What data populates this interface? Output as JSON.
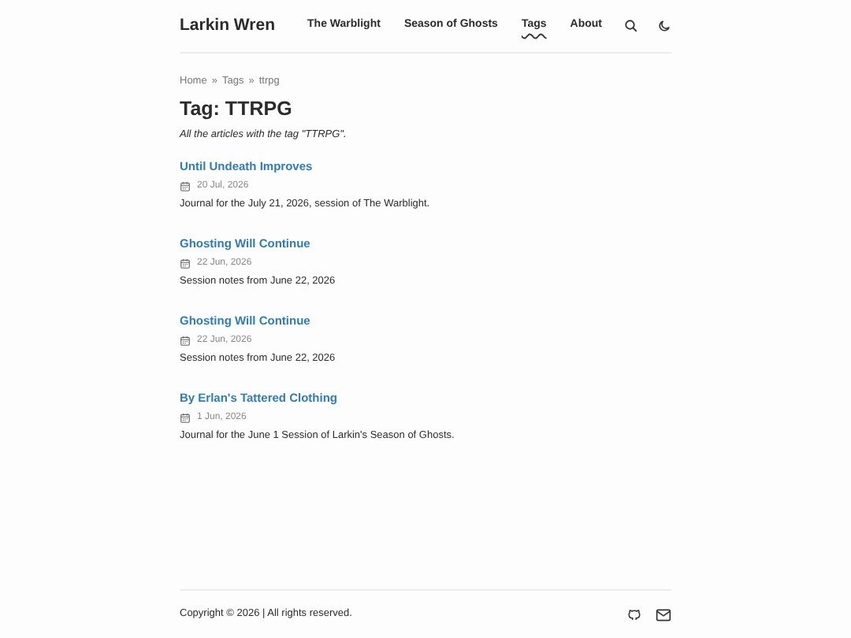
{
  "site_title": "Larkin Wren",
  "nav": [
    {
      "label": "The Warblight",
      "selected": false
    },
    {
      "label": "Season of Ghosts",
      "selected": false
    },
    {
      "label": "Tags",
      "selected": true
    },
    {
      "label": "About",
      "selected": false
    }
  ],
  "breadcrumbs": {
    "separator": "»",
    "items": [
      "Home",
      "Tags",
      "ttrpg"
    ]
  },
  "heading": "Tag: TTRPG",
  "subtitle": "All the articles with the tag \"TTRPG\".",
  "articles": [
    {
      "title": "Until Undeath Improves",
      "date": "20 Jul, 2026",
      "summary": "Journal for the July 21, 2026, session of The Warblight."
    },
    {
      "title": "Ghosting Will Continue",
      "date": "22 Jun, 2026",
      "summary": "Session notes from June 22, 2026"
    },
    {
      "title": "Ghosting Will Continue",
      "date": "22 Jun, 2026",
      "summary": "Session notes from June 22, 2026"
    },
    {
      "title": "By Erlan's Tattered Clothing",
      "date": "1 Jun, 2026",
      "summary": "Journal for the June 1 Session of Larkin's Season of Ghosts."
    }
  ],
  "footer": {
    "copyright": "Copyright © 2026 | All rights reserved."
  }
}
